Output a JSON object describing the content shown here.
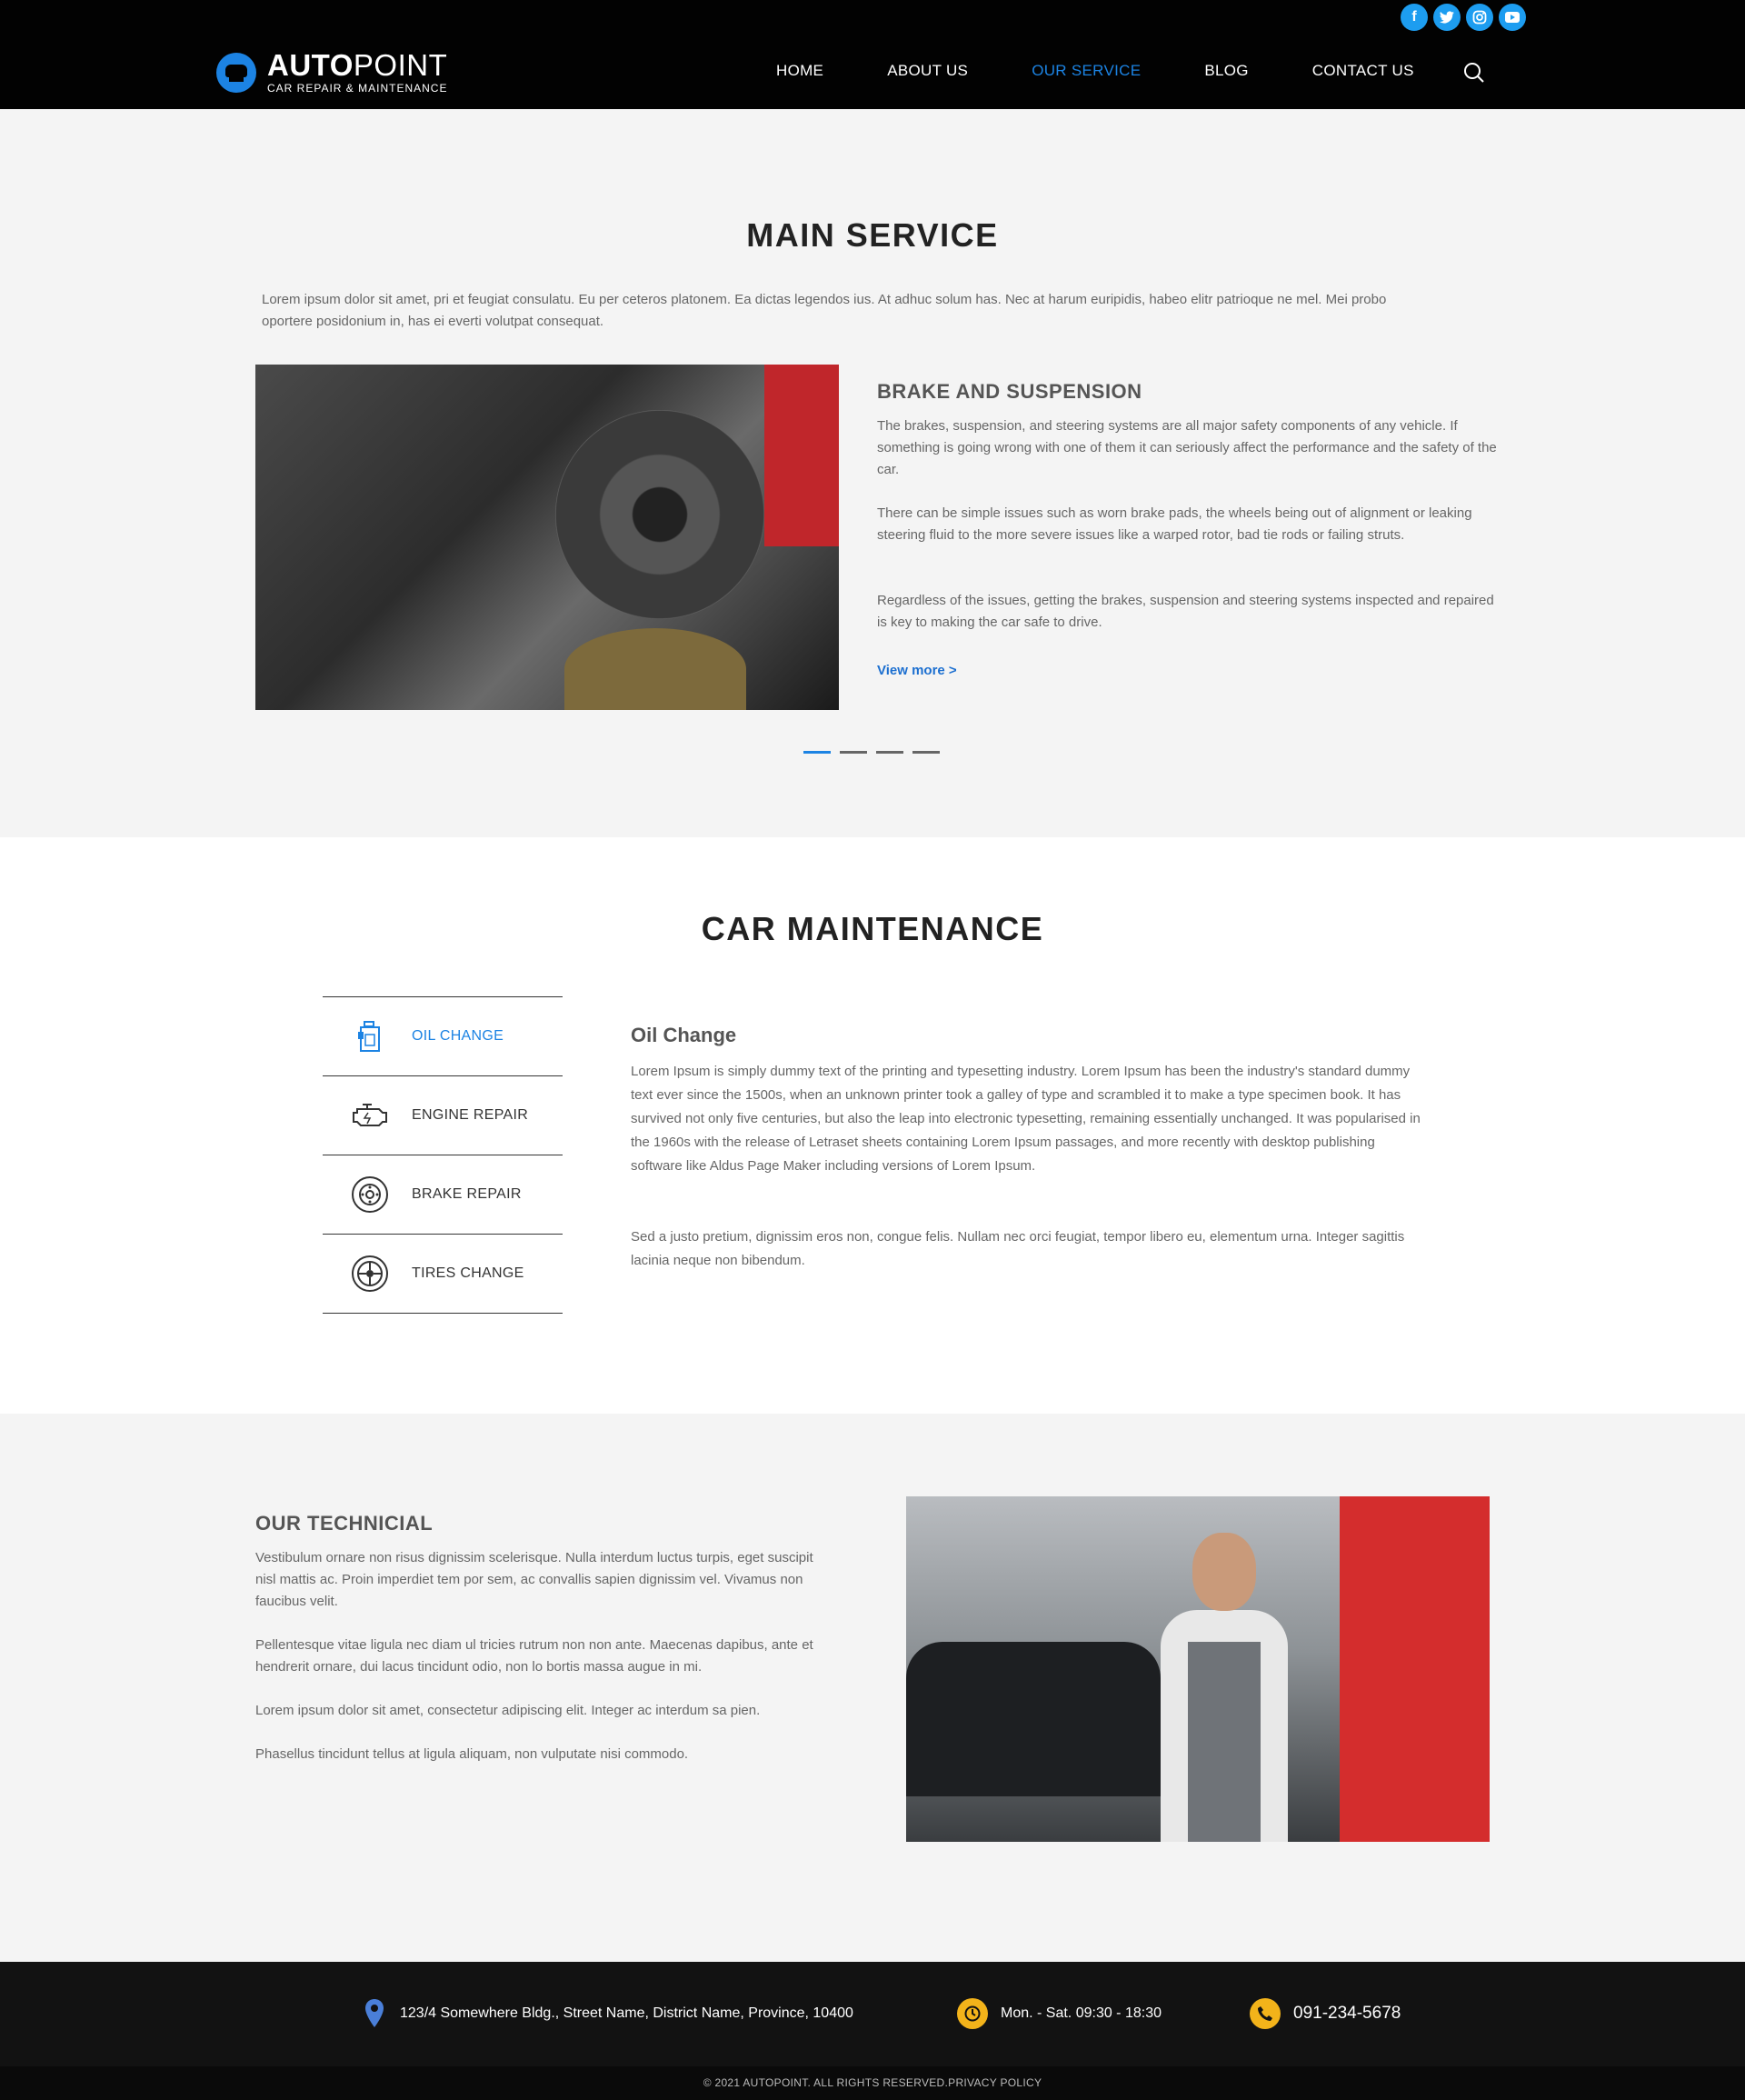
{
  "header": {
    "logo_bold": "AUTO",
    "logo_light": "POINT",
    "logo_sub": "CAR REPAIR & MAINTENANCE",
    "nav": [
      "HOME",
      "ABOUT US",
      "OUR SERVICE",
      "BLOG",
      "CONTACT US"
    ],
    "active_nav": "OUR SERVICE",
    "social": [
      "facebook-icon",
      "twitter-icon",
      "instagram-icon",
      "youtube-icon"
    ]
  },
  "main_service": {
    "title": "MAIN SERVICE",
    "intro": "Lorem ipsum dolor sit amet, pri et feugiat consulatu. Eu per ceteros platonem. Ea dictas legendos ius. At adhuc solum has. Nec at harum euripidis, habeo elitr patrioque ne mel. Mei probo oportere posidonium in, has ei everti volutpat consequat.",
    "slide_title": "BRAKE AND SUSPENSION",
    "paragraphs": [
      "The brakes, suspension, and steering systems are all major safety components of any vehicle. If something is going wrong with one of them it can seriously affect the performance and the safety of the car.",
      "There can be simple issues such as worn brake pads, the wheels being out of alignment or leaking steering fluid to the more severe issues like a warped rotor, bad tie rods or failing struts.",
      "Regardless of the issues, getting the brakes, suspension and steering systems inspected and repaired is key to making the car safe to drive."
    ],
    "view_more": "View more >"
  },
  "car_maintenance": {
    "title": "CAR MAINTENANCE",
    "tabs": [
      {
        "label": "OIL CHANGE",
        "icon": "oil-bottle-icon"
      },
      {
        "label": "ENGINE REPAIR",
        "icon": "engine-icon"
      },
      {
        "label": "BRAKE REPAIR",
        "icon": "brake-disc-icon"
      },
      {
        "label": "TIRES CHANGE",
        "icon": "tire-icon"
      }
    ],
    "content_title": "Oil Change",
    "paragraphs": [
      "Lorem Ipsum is simply dummy text of the printing and typesetting industry. Lorem Ipsum has been the industry's standard dummy text ever since the 1500s, when an unknown printer took a galley of type and scrambled it to make a type specimen book. It has survived not only five centuries, but also the leap into electronic typesetting, remaining essentially unchanged. It was popularised in the 1960s with the release of Letraset sheets containing Lorem Ipsum passages, and more recently with desktop publishing software like Aldus Page Maker including versions of Lorem Ipsum.",
      "Sed a justo pretium, dignissim eros non, congue felis. Nullam nec orci feugiat, tempor libero eu, elementum urna. Integer sagittis lacinia neque non bibendum."
    ]
  },
  "technician": {
    "title": "OUR TECHNICIAL",
    "paragraphs": [
      "Vestibulum ornare non risus dignissim scelerisque. Nulla interdum luctus turpis, eget suscipit nisl mattis ac. Proin imperdiet tem por sem, ac convallis sapien dignissim vel. Vivamus non faucibus velit.",
      "Pellentesque vitae ligula nec diam ul tricies rutrum non non ante. Maecenas dapibus, ante et hendrerit ornare, dui lacus tincidunt odio, non lo bortis massa augue in mi.",
      "Lorem ipsum dolor sit amet, consectetur adipiscing elit. Integer ac interdum sa pien.",
      "Phasellus tincidunt tellus at ligula aliquam, non vulputate nisi commodo."
    ]
  },
  "footer": {
    "address": "123/4 Somewhere Bldg., Street Name, District Name, Province, 10400",
    "hours": "Mon. - Sat.  09:30 - 18:30",
    "phone": "091-234-5678",
    "copyright": "©  2021 AUTOPOINT. ALL RIGHTS RESERVED.PRIVACY POLICY"
  },
  "colors": {
    "accent": "#1c83e3",
    "footer_icon": "#f3b31a",
    "header_bg": "#020202"
  }
}
